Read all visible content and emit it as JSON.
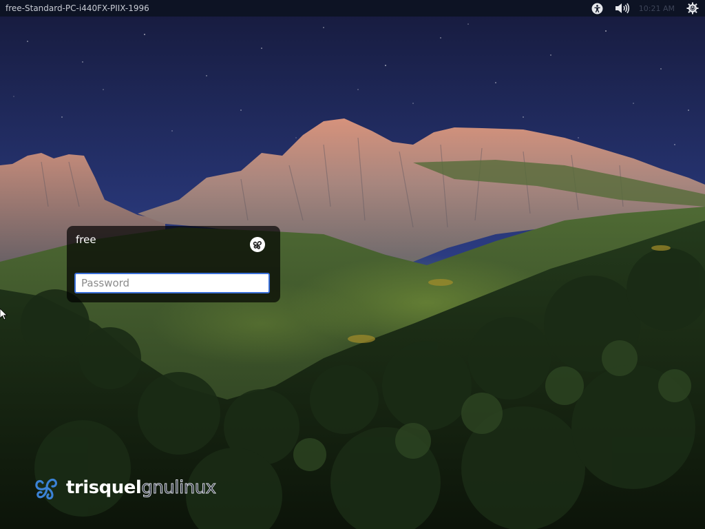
{
  "top_panel": {
    "hostname": "free-Standard-PC-i440FX-PIIX-1996",
    "clock": "10:21 AM",
    "icons": [
      "accessibility-icon",
      "volume-icon",
      "power-icon"
    ]
  },
  "login": {
    "username": "free",
    "password_placeholder": "Password",
    "session_icon": "trisquel-session-icon",
    "focus_color": "#3a6fd8"
  },
  "branding": {
    "word1": "trisquel",
    "word2": "gnulinux",
    "logo_icon": "triskelion-logo-icon",
    "logo_color": "#3b82d6"
  },
  "colors": {
    "panel_bg": "#0d1324",
    "sky_top": "#14193b",
    "sky_bottom": "#4d63b5"
  }
}
